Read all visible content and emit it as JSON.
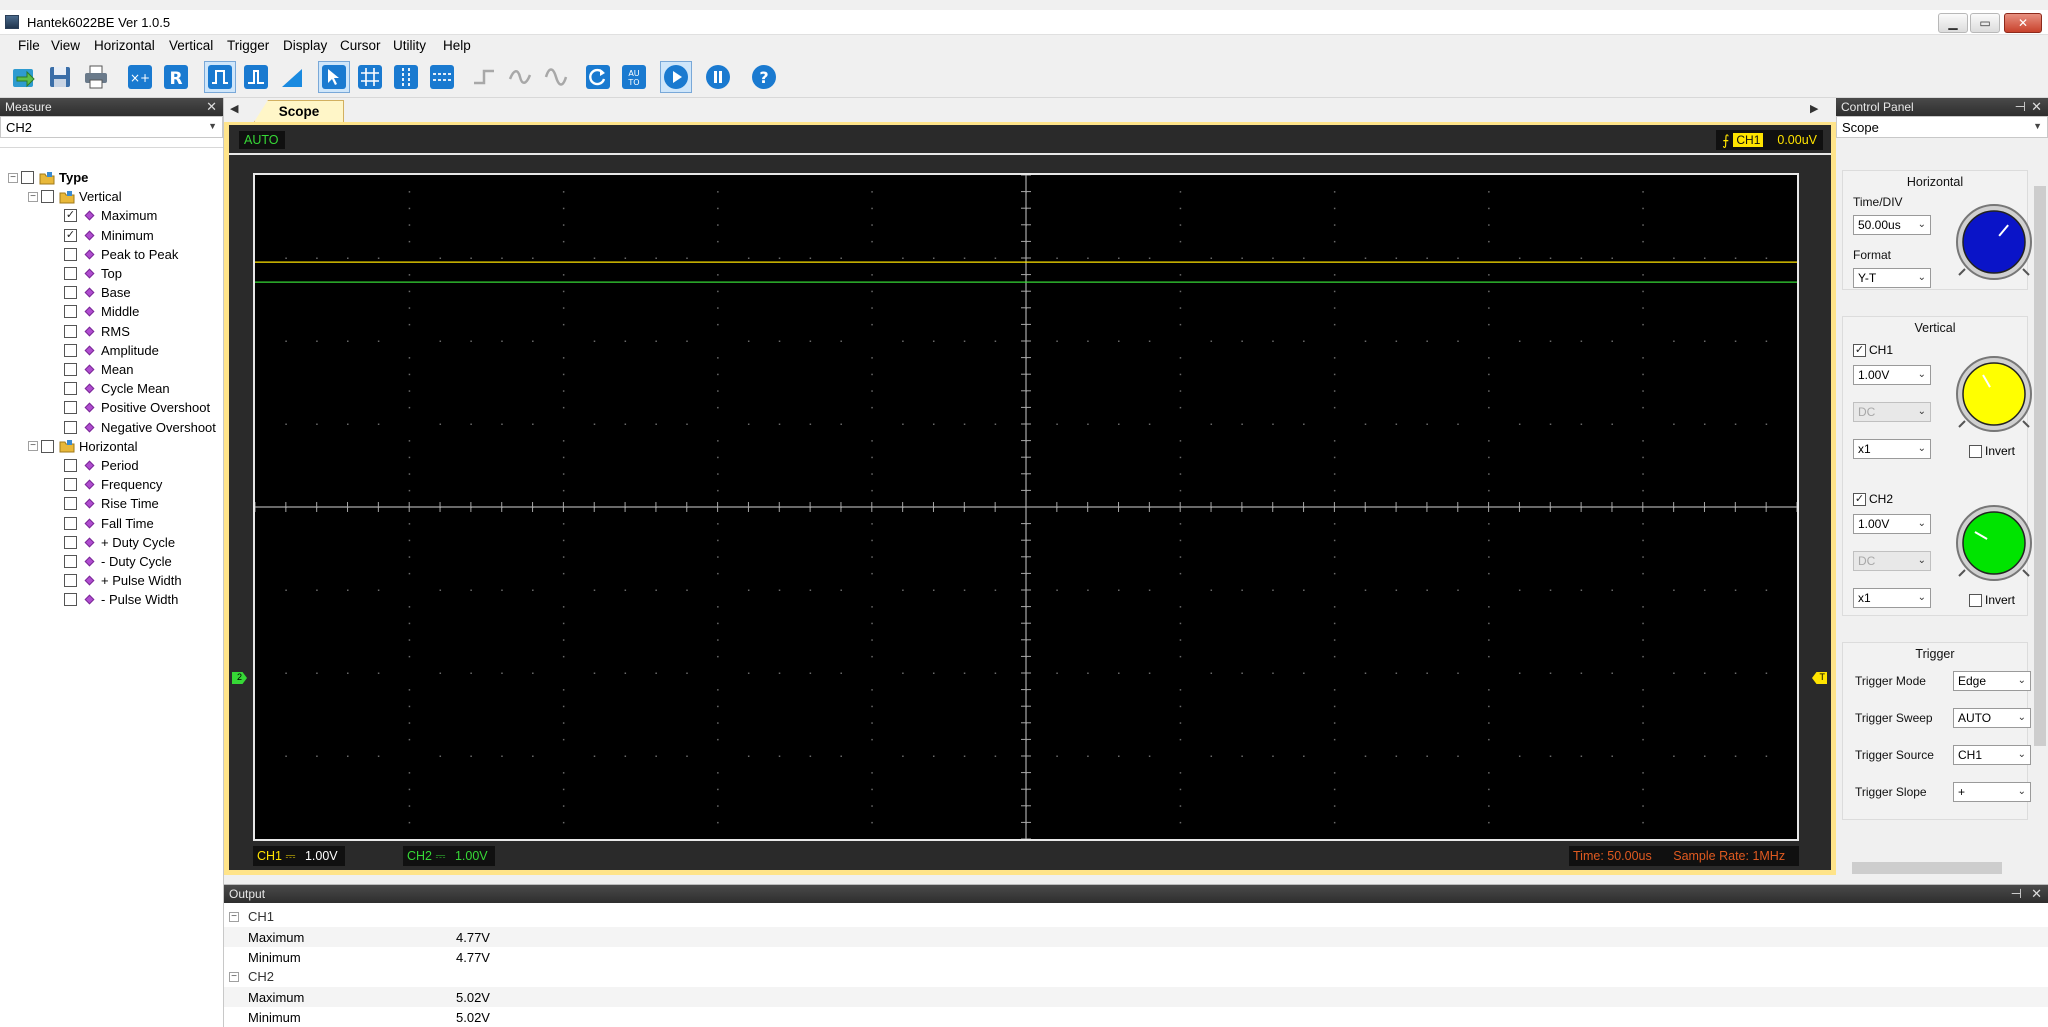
{
  "window": {
    "title": "Hantek6022BE Ver 1.0.5"
  },
  "menu": [
    "File",
    "View",
    "Horizontal",
    "Vertical",
    "Trigger",
    "Display",
    "Cursor",
    "Utility",
    "Help"
  ],
  "measure_panel": {
    "title": "Measure",
    "channel": "CH2",
    "root": "Type",
    "groups": [
      {
        "label": "Vertical",
        "items": [
          {
            "label": "Maximum",
            "checked": true
          },
          {
            "label": "Minimum",
            "checked": true
          },
          {
            "label": "Peak to Peak",
            "checked": false
          },
          {
            "label": "Top",
            "checked": false
          },
          {
            "label": "Base",
            "checked": false
          },
          {
            "label": "Middle",
            "checked": false
          },
          {
            "label": "RMS",
            "checked": false
          },
          {
            "label": "Amplitude",
            "checked": false
          },
          {
            "label": "Mean",
            "checked": false
          },
          {
            "label": "Cycle Mean",
            "checked": false
          },
          {
            "label": "Positive Overshoot",
            "checked": false
          },
          {
            "label": "Negative Overshoot",
            "checked": false
          }
        ]
      },
      {
        "label": "Horizontal",
        "items": [
          {
            "label": "Period",
            "checked": false
          },
          {
            "label": "Frequency",
            "checked": false
          },
          {
            "label": "Rise Time",
            "checked": false
          },
          {
            "label": "Fall Time",
            "checked": false
          },
          {
            "label": "+ Duty Cycle",
            "checked": false
          },
          {
            "label": "- Duty Cycle",
            "checked": false
          },
          {
            "label": "+ Pulse Width",
            "checked": false
          },
          {
            "label": "- Pulse Width",
            "checked": false
          }
        ]
      }
    ]
  },
  "scope": {
    "tab": "Scope",
    "mode": "AUTO",
    "trigger_source": "CH1",
    "trigger_level": "0.00uV",
    "ch1_scale": "1.00V",
    "ch2_scale": "1.00V",
    "ch1_label": "CH1",
    "ch2_label": "CH2",
    "coupling_symbol": "⎓",
    "time_info": "Time: 50.00us",
    "sample_rate": "Sample Rate: 1MHz",
    "ch2_marker": "2",
    "trigger_marker": "T",
    "grid_divisions": {
      "x": 10,
      "y": 8
    },
    "traces": [
      {
        "channel": "CH1",
        "level_div": 2.95,
        "color": "#ffe400"
      },
      {
        "channel": "CH2",
        "level_div": 2.95,
        "color": "#36d836"
      }
    ]
  },
  "output": {
    "title": "Output",
    "groups": [
      {
        "label": "CH1",
        "rows": [
          {
            "k": "Maximum",
            "v": "4.77V"
          },
          {
            "k": "Minimum",
            "v": "4.77V"
          }
        ]
      },
      {
        "label": "CH2",
        "rows": [
          {
            "k": "Maximum",
            "v": "5.02V"
          },
          {
            "k": "Minimum",
            "v": "5.02V"
          }
        ]
      }
    ]
  },
  "control_panel": {
    "title": "Control Panel",
    "mode": "Scope",
    "horizontal": {
      "title": "Horizontal",
      "timediv_label": "Time/DIV",
      "timediv": "50.00us",
      "format_label": "Format",
      "format": "Y-T",
      "knob_color": "#0a14c8"
    },
    "vertical": {
      "title": "Vertical",
      "ch1": {
        "label": "CH1",
        "enabled": true,
        "volts": "1.00V",
        "coupling": "DC",
        "probe": "x1",
        "invert_label": "Invert",
        "invert": false,
        "knob_color": "#ffff00"
      },
      "ch2": {
        "label": "CH2",
        "enabled": true,
        "volts": "1.00V",
        "coupling": "DC",
        "probe": "x1",
        "invert_label": "Invert",
        "invert": false,
        "knob_color": "#00e400"
      }
    },
    "trigger": {
      "title": "Trigger",
      "mode_label": "Trigger Mode",
      "mode": "Edge",
      "sweep_label": "Trigger Sweep",
      "sweep": "AUTO",
      "source_label": "Trigger Source",
      "source": "CH1",
      "slope_label": "Trigger Slope",
      "slope": "+"
    }
  },
  "toolbar_icons": [
    "open-icon",
    "save-icon",
    "print-icon",
    "measure-add-icon",
    "reference-icon",
    "square-wave-icon",
    "pulse-icon",
    "ramp-icon",
    "cursor-select-icon",
    "grid-icon",
    "cursor-vertical-icon",
    "cursor-horizontal-icon",
    "step-icon",
    "sine-filter-icon",
    "sine-icon",
    "refresh-icon",
    "auto-icon",
    "run-icon",
    "pause-icon",
    "help-icon"
  ]
}
